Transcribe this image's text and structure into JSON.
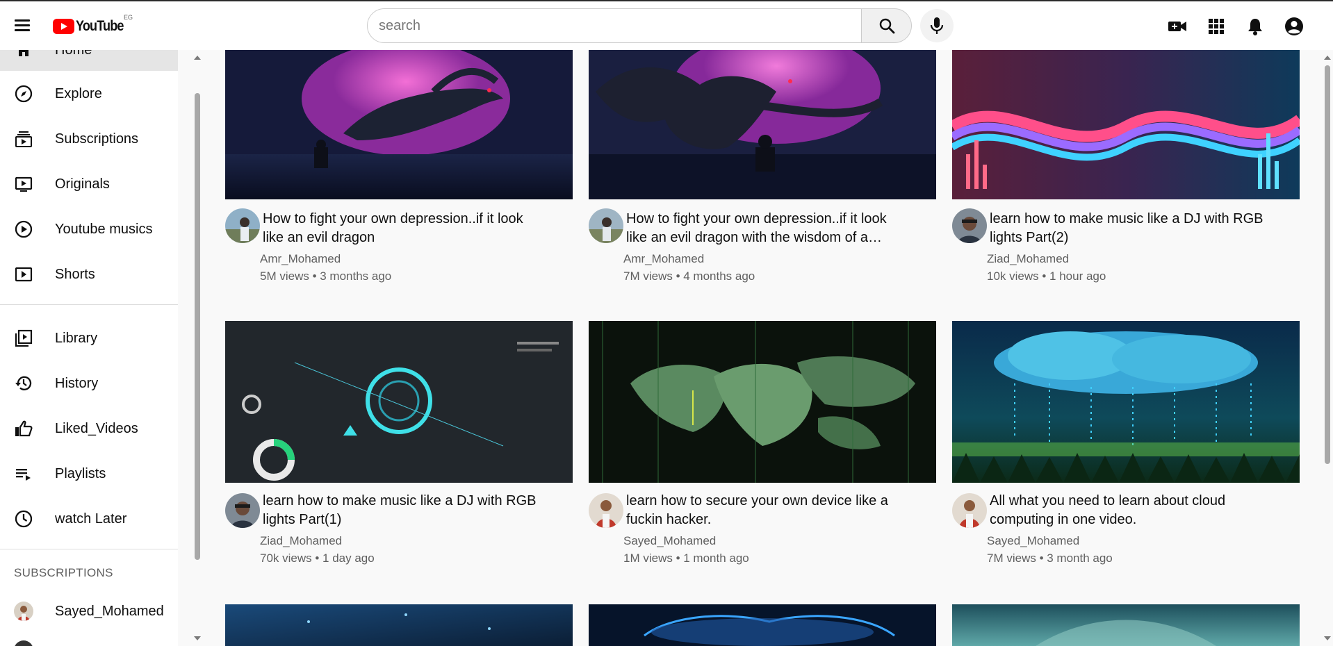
{
  "header": {
    "logo_text": "YouTube",
    "country_code": "EG",
    "search_placeholder": "search",
    "icons": [
      "menu-icon",
      "search-icon",
      "mic-icon",
      "create-video-icon",
      "apps-grid-icon",
      "notifications-bell-icon",
      "account-icon"
    ]
  },
  "sidebar": {
    "items": [
      {
        "label": "Home",
        "icon": "home-icon",
        "active": true
      },
      {
        "label": "Explore",
        "icon": "compass-icon"
      },
      {
        "label": "Subscriptions",
        "icon": "subscriptions-icon"
      },
      {
        "label": "Originals",
        "icon": "originals-icon"
      },
      {
        "label": "Youtube musics",
        "icon": "music-play-icon"
      },
      {
        "label": "Shorts",
        "icon": "shorts-icon"
      },
      {
        "label": "Library",
        "icon": "library-icon"
      },
      {
        "label": "History",
        "icon": "history-icon"
      },
      {
        "label": "Liked_Videos",
        "icon": "thumbs-up-icon"
      },
      {
        "label": "Playlists",
        "icon": "playlist-icon"
      },
      {
        "label": "watch Later",
        "icon": "clock-icon"
      }
    ],
    "subscriptions_title": "SUBSCRIPTIONS",
    "subscriptions": [
      {
        "name": "Sayed_Mohamed"
      }
    ]
  },
  "videos": [
    {
      "title": "How to fight your own depression..if it look like an evil dragon",
      "channel": "Amr_Mohamed",
      "meta": "5M views • 3 months ago"
    },
    {
      "title": "How to fight your own depression..if it look like an evil dragon with the wisdom of a…",
      "channel": "Amr_Mohamed",
      "meta": "7M views • 4 months ago"
    },
    {
      "title": "learn how to make music like a DJ with RGB lights Part(2)",
      "channel": "Ziad_Mohamed",
      "meta": "10k views • 1 hour ago"
    },
    {
      "title": "learn how to make music like a DJ with RGB lights Part(1)",
      "channel": "Ziad_Mohamed",
      "meta": "70k views • 1 day ago"
    },
    {
      "title": "learn how to secure your own device like a fuckin hacker.",
      "channel": "Sayed_Mohamed",
      "meta": "1M views • 1 month ago"
    },
    {
      "title": "All what you need to learn about cloud computing in one video.",
      "channel": "Sayed_Mohamed",
      "meta": "7M views • 3 month ago"
    }
  ],
  "colors": {
    "brand": "#ff0000",
    "active_bg": "#e5e5e5",
    "secondary_text": "#606060"
  }
}
